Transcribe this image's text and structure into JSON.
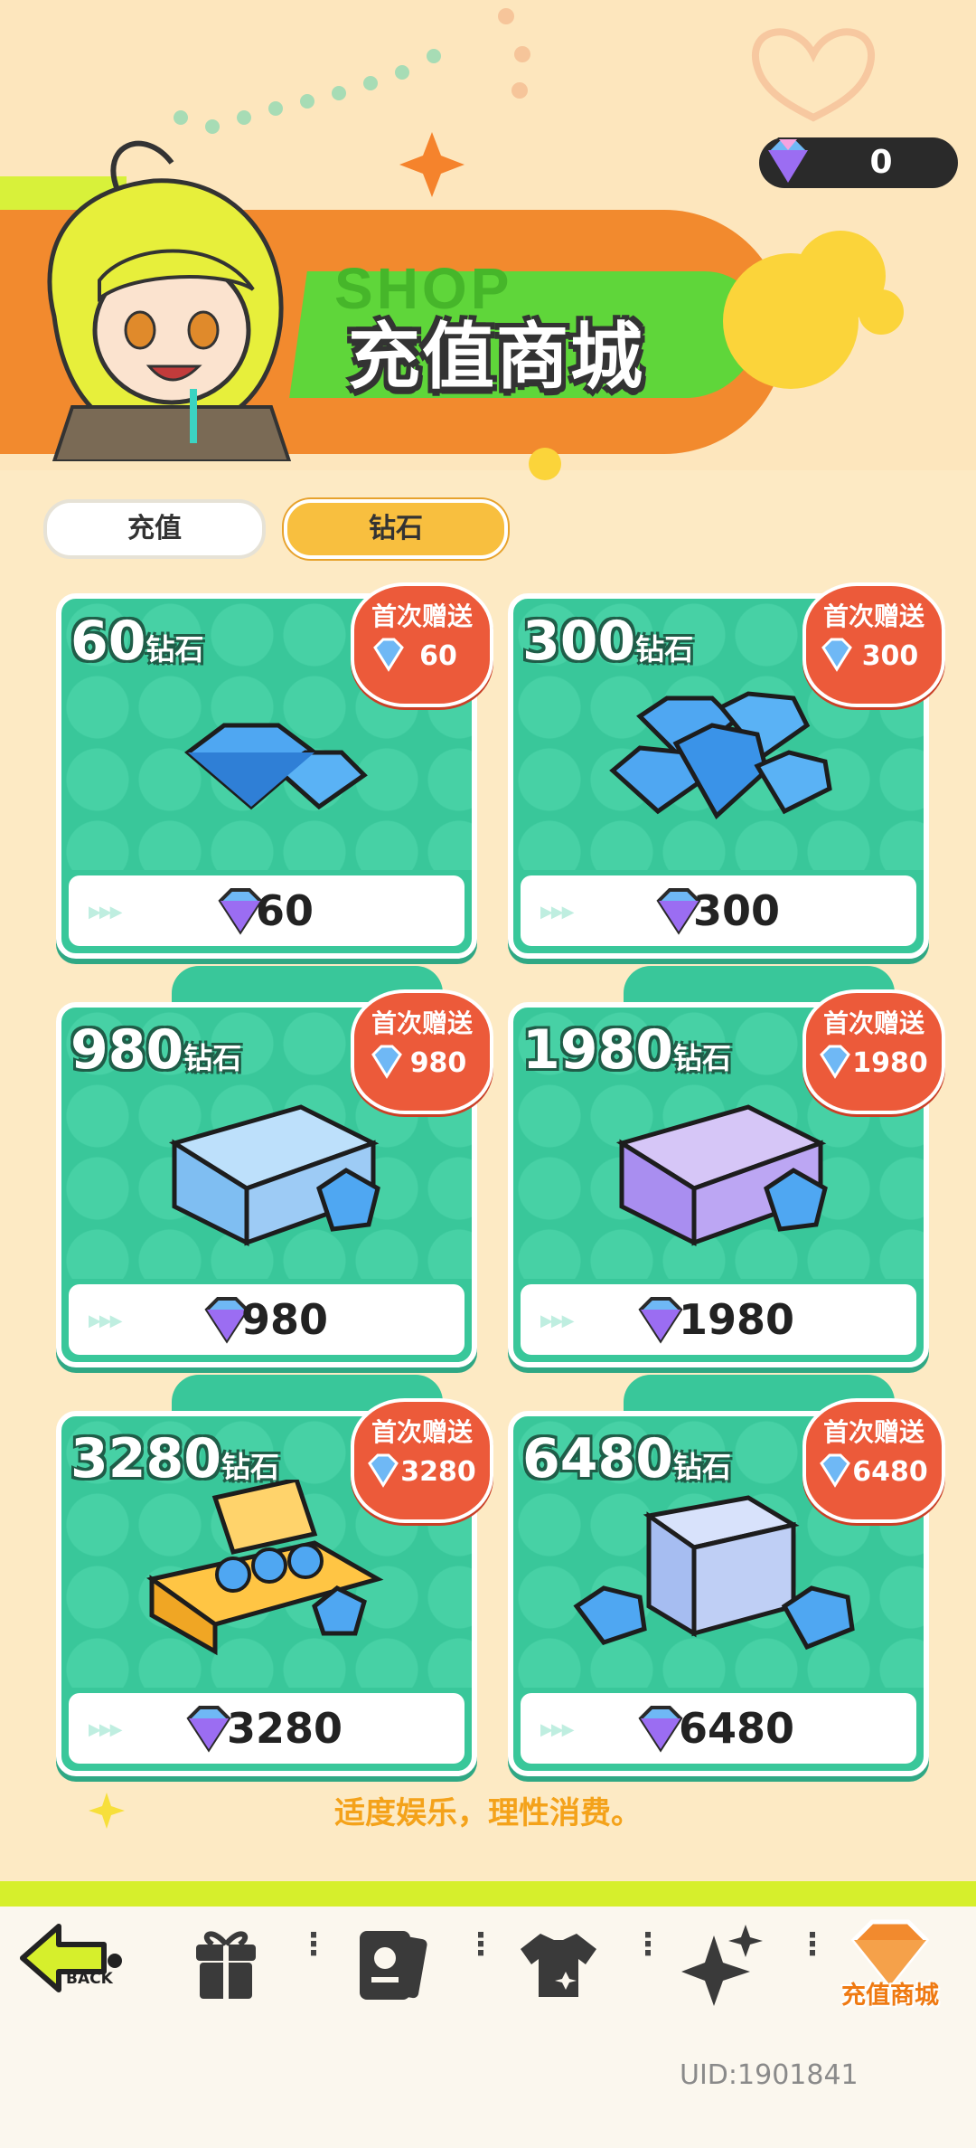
{
  "currency": {
    "icon": "diamond-icon",
    "value": "0"
  },
  "header": {
    "ghost_text": "SHOP",
    "title": "充值商城"
  },
  "tabs": [
    {
      "label": "充值",
      "active": false
    },
    {
      "label": "钻石",
      "active": true
    }
  ],
  "products": [
    {
      "amount": "60",
      "unit": "钻石",
      "badge_label": "首次赠送",
      "badge_value": "60",
      "price": "60"
    },
    {
      "amount": "300",
      "unit": "钻石",
      "badge_label": "首次赠送",
      "badge_value": "300",
      "price": "300"
    },
    {
      "amount": "980",
      "unit": "钻石",
      "badge_label": "首次赠送",
      "badge_value": "980",
      "price": "980"
    },
    {
      "amount": "1980",
      "unit": "钻石",
      "badge_label": "首次赠送",
      "badge_value": "1980",
      "price": "1980"
    },
    {
      "amount": "3280",
      "unit": "钻石",
      "badge_label": "首次赠送",
      "badge_value": "3280",
      "price": "3280"
    },
    {
      "amount": "6480",
      "unit": "钻石",
      "badge_label": "首次赠送",
      "badge_value": "6480",
      "price": "6480"
    }
  ],
  "notice": "适度娱乐，理性消费。",
  "nav": {
    "back_label": "BACK",
    "items": [
      "gift-icon",
      "card-icon",
      "shirt-icon",
      "sparkle-icon",
      "shop-icon"
    ],
    "shop_label": "充值商城"
  },
  "uid": "UID:1901841",
  "colors": {
    "accent_orange": "#f28a2e",
    "card_green": "#39c79a",
    "badge_red": "#ec5a3a",
    "tab_active": "#f8bf3f"
  }
}
